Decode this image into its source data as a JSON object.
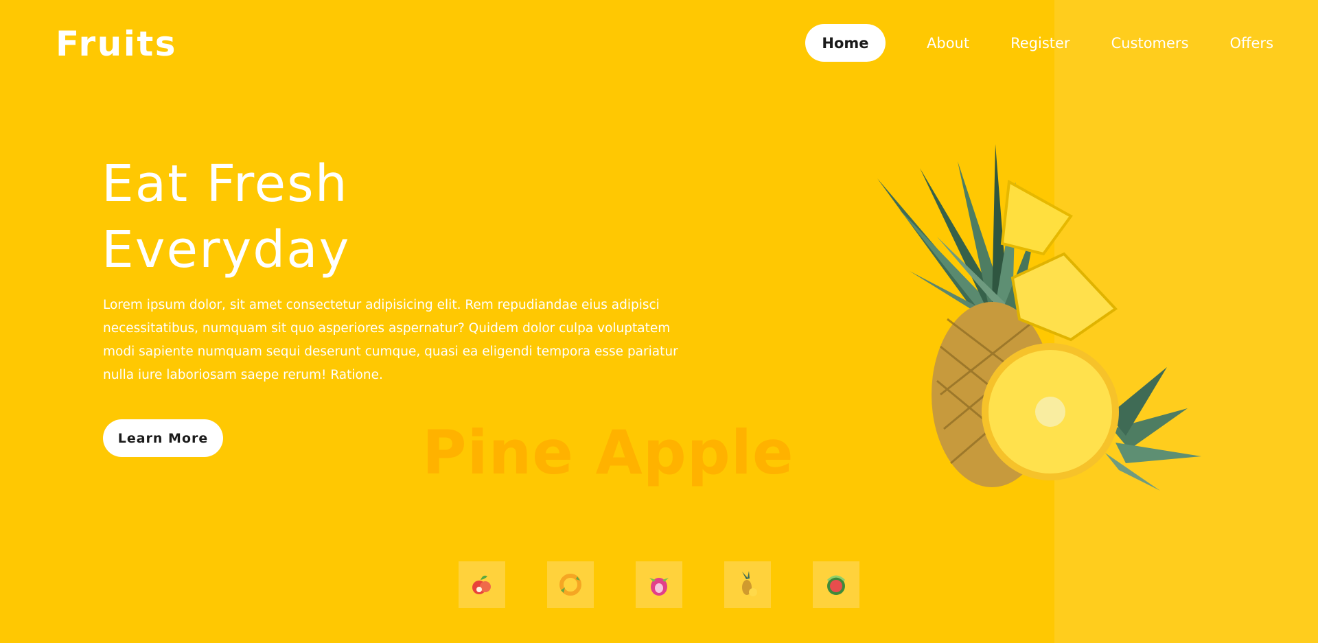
{
  "brand": {
    "logo_text": "Fruits"
  },
  "nav": {
    "items": [
      {
        "label": "Home",
        "active": true
      },
      {
        "label": "About",
        "active": false
      },
      {
        "label": "Register",
        "active": false
      },
      {
        "label": "Customers",
        "active": false
      },
      {
        "label": "Offers",
        "active": false
      }
    ]
  },
  "hero": {
    "title_line1": "Eat Fresh",
    "title_line2": "Everyday",
    "description": "Lorem ipsum dolor, sit amet consectetur adipisicing elit. Rem repudiandae eius adipisci necessitatibus, numquam sit quo asperiores aspernatur? Quidem dolor culpa voluptatem modi sapiente numquam sequi deserunt cumque, quasi ea eligendi tempora esse pariatur nulla iure laboriosam saepe rerum! Ratione.",
    "cta_label": "Learn More",
    "watermark": "Pine Apple",
    "image_icon": "pineapple-illustration"
  },
  "thumbnails": [
    {
      "icon": "apple-icon"
    },
    {
      "icon": "orange-slices-icon"
    },
    {
      "icon": "dragon-fruit-icon"
    },
    {
      "icon": "pineapple-icon"
    },
    {
      "icon": "watermelon-icon"
    }
  ],
  "colors": {
    "background": "#ffc802",
    "right_panel": "#ffcd1d",
    "watermark_text": "#ffb200",
    "button_bg": "#ffffff",
    "button_text": "#1a1a1a"
  }
}
